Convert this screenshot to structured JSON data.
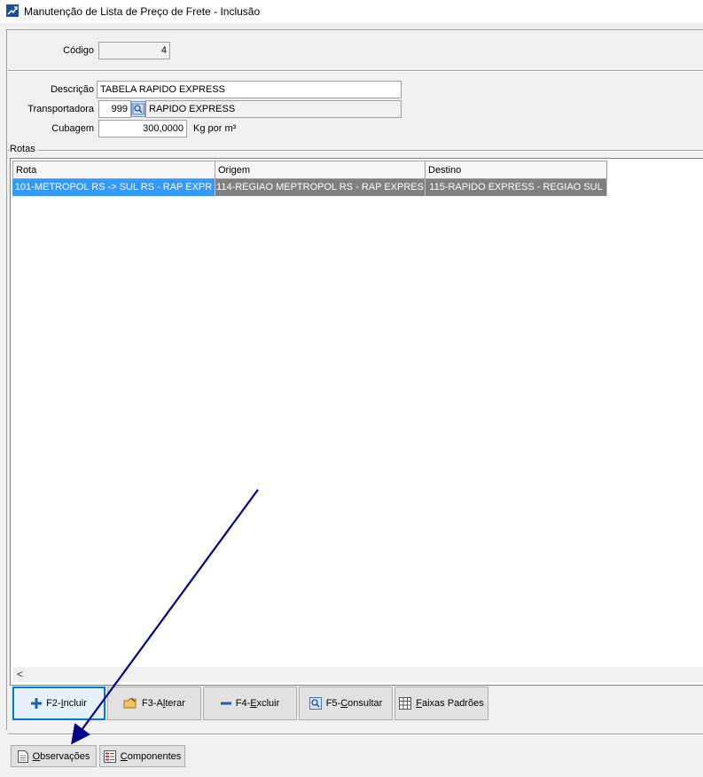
{
  "window": {
    "title": "Manutenção de Lista de Preço de Frete - Inclusão"
  },
  "form": {
    "codigo_label": "Código",
    "codigo_value": "4",
    "descricao_label": "Descrição",
    "descricao_value": "TABELA RAPIDO EXPRESS",
    "transportadora_label": "Transportadora",
    "transportadora_code": "999",
    "transportadora_name": "RAPIDO EXPRESS",
    "cubagem_label": "Cubagem",
    "cubagem_value": "300,0000",
    "cubagem_unit": "Kg por m³"
  },
  "rotas": {
    "group_label": "Rotas",
    "columns": [
      "Rota",
      "Origem",
      "Destino"
    ],
    "rows": [
      [
        "101-METROPOL RS -> SUL RS - RAP EXPR",
        "114-REGIAO MEPTROPOL RS - RAP EXPRES",
        "115-RAPIDO EXPRESS - REGIAO SUL"
      ]
    ],
    "scroll_left": "<"
  },
  "buttons": {
    "incluir": {
      "pre": "F2-",
      "key": "I",
      "post": "ncluir"
    },
    "alterar": {
      "pre": "F3-A",
      "key": "l",
      "post": "terar"
    },
    "excluir": {
      "pre": "F4-",
      "key": "E",
      "post": "xcluir"
    },
    "consultar": {
      "pre": "F5-",
      "key": "C",
      "post": "onsultar"
    },
    "faixas": {
      "pre": "",
      "key": "F",
      "post": "aixas Padrões"
    },
    "observacoes": {
      "pre": "",
      "key": "O",
      "post": "bservações"
    },
    "componentes": {
      "pre": "",
      "key": "C",
      "post": "omponentes"
    }
  },
  "colors": {
    "selection": "#3399ff",
    "arrow": "#00008b"
  }
}
